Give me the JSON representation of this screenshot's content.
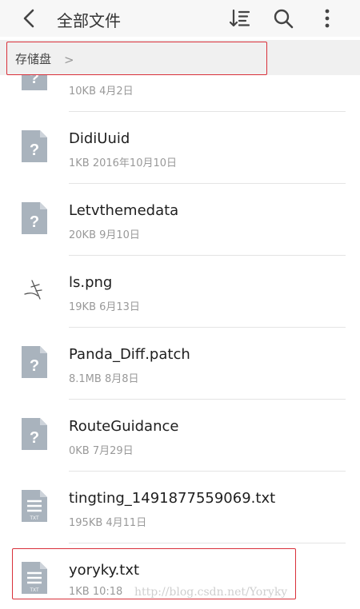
{
  "header": {
    "title": "全部文件",
    "back_icon": "back-arrow-icon",
    "sort_icon": "sort-icon",
    "search_icon": "search-icon",
    "more_icon": "more-vertical-icon"
  },
  "breadcrumb": {
    "label": "存储盘",
    "separator": ">"
  },
  "files": [
    {
      "name": "",
      "meta": "10KB  4月2日",
      "icon": "unknown-file-icon"
    },
    {
      "name": "DidiUuid",
      "meta": "1KB  2016年10月10日",
      "icon": "unknown-file-icon"
    },
    {
      "name": "Letvthemedata",
      "meta": "20KB  9月10日",
      "icon": "unknown-file-icon"
    },
    {
      "name": "ls.png",
      "meta": "19KB  6月13日",
      "icon": "image-thumbnail-icon"
    },
    {
      "name": "Panda_Diff.patch",
      "meta": "8.1MB  8月8日",
      "icon": "unknown-file-icon"
    },
    {
      "name": "RouteGuidance",
      "meta": "0KB  7月29日",
      "icon": "unknown-file-icon"
    },
    {
      "name": "tingting_1491877559069.txt",
      "meta": "195KB  4月11日",
      "icon": "txt-file-icon"
    },
    {
      "name": "yoryky.txt",
      "meta": "1KB  10:18",
      "icon": "txt-file-icon"
    }
  ],
  "watermark": "http://blog.csdn.net/Yoryky",
  "colors": {
    "accent_highlight": "#d9303a",
    "icon_gray": "#a9b3bd"
  }
}
